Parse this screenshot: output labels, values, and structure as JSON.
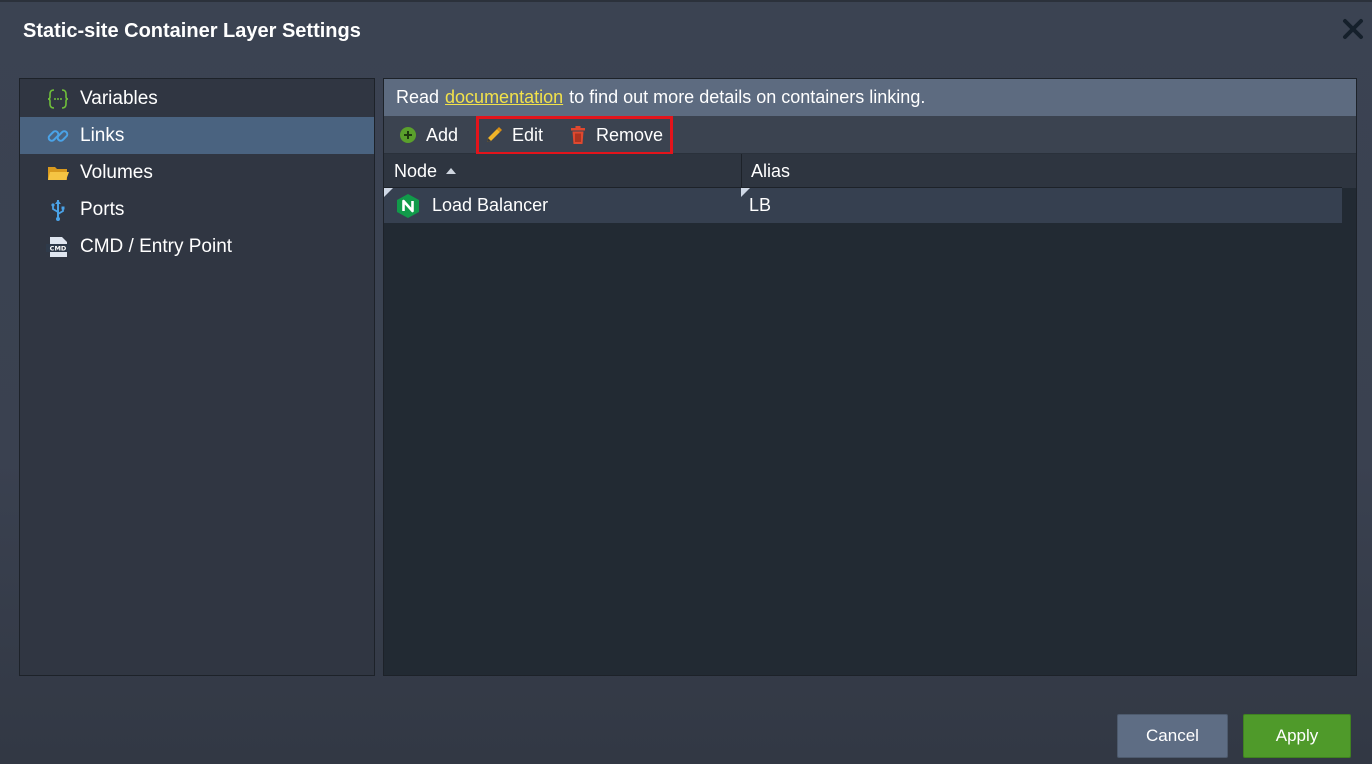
{
  "dialog": {
    "title": "Static-site Container Layer Settings"
  },
  "sidebar": {
    "items": [
      {
        "label": "Variables",
        "icon": "braces-icon"
      },
      {
        "label": "Links",
        "icon": "link-icon",
        "active": true
      },
      {
        "label": "Volumes",
        "icon": "folder-icon"
      },
      {
        "label": "Ports",
        "icon": "usb-icon"
      },
      {
        "label": "CMD / Entry Point",
        "icon": "cmd-icon"
      }
    ]
  },
  "info": {
    "prefix": "Read",
    "link_text": "documentation",
    "suffix": "to find out more details on containers linking."
  },
  "toolbar": {
    "add_label": "Add",
    "edit_label": "Edit",
    "remove_label": "Remove"
  },
  "grid": {
    "columns": [
      {
        "label": "Node",
        "sort": "ascending"
      },
      {
        "label": "Alias"
      }
    ],
    "rows": [
      {
        "node": "Load Balancer",
        "alias": "LB",
        "node_icon": "nginx-icon"
      }
    ]
  },
  "footer": {
    "cancel_label": "Cancel",
    "apply_label": "Apply"
  },
  "colors": {
    "accent_active": "#4a6380",
    "link": "#f2e24a",
    "apply": "#4f9a2a",
    "highlight": "#e3141b"
  }
}
